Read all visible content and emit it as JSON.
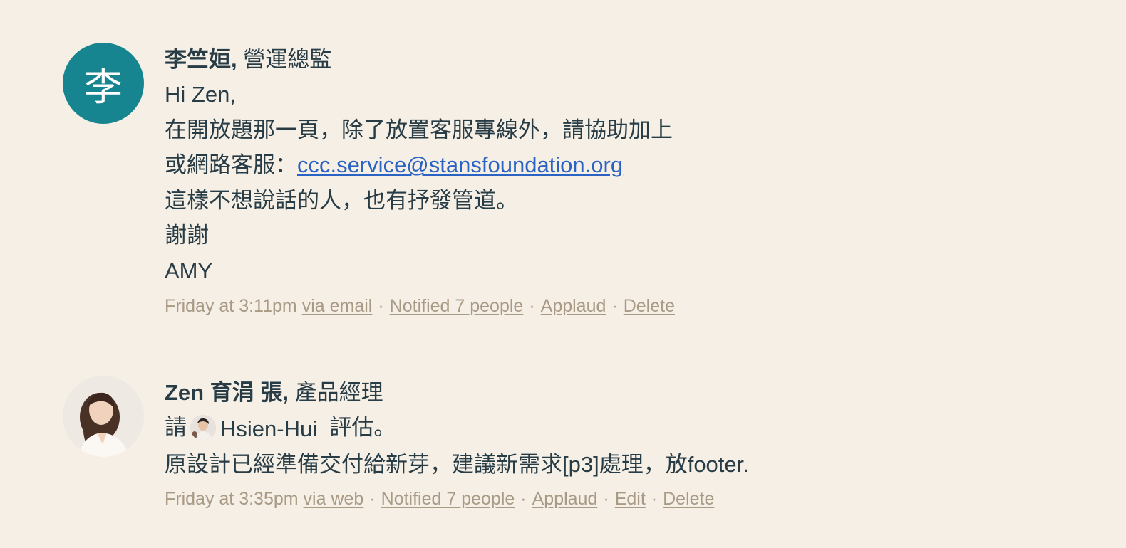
{
  "comments": [
    {
      "avatar_letter": "李",
      "author_name": "李竺姮,",
      "author_title": "營運總監",
      "lines": [
        "Hi Zen,",
        "在開放題那一頁，除了放置客服專線外，請協助加上",
        "或網路客服：",
        "這樣不想說話的人，也有抒發管道。",
        "謝謝",
        "AMY"
      ],
      "email_link": "ccc.service@stansfoundation.org",
      "meta": {
        "time": "Friday at 3:11pm",
        "via": "via email",
        "notified": "Notified 7 people",
        "applaud": "Applaud",
        "delete": "Delete"
      }
    },
    {
      "author_name": "Zen 育涓 張,",
      "author_title": "產品經理",
      "line1_prefix": "請",
      "mention_name": "Hsien-Hui",
      "line1_suffix": "評估。",
      "line2": "原設計已經準備交付給新芽，建議新需求[p3]處理，放footer.",
      "meta": {
        "time": "Friday at 3:35pm",
        "via": "via web",
        "notified": "Notified 7 people",
        "applaud": "Applaud",
        "edit": "Edit",
        "delete": "Delete"
      }
    }
  ],
  "icons": {
    "avatar_1": "letter-avatar",
    "avatar_2": "user-photo-avatar",
    "mention_avatar": "user-photo-avatar"
  },
  "colors": {
    "background": "#f6efe6",
    "text": "#283c46",
    "avatar_teal": "#178590",
    "link_blue": "#2a63c4",
    "meta_tan": "#a99a85"
  }
}
